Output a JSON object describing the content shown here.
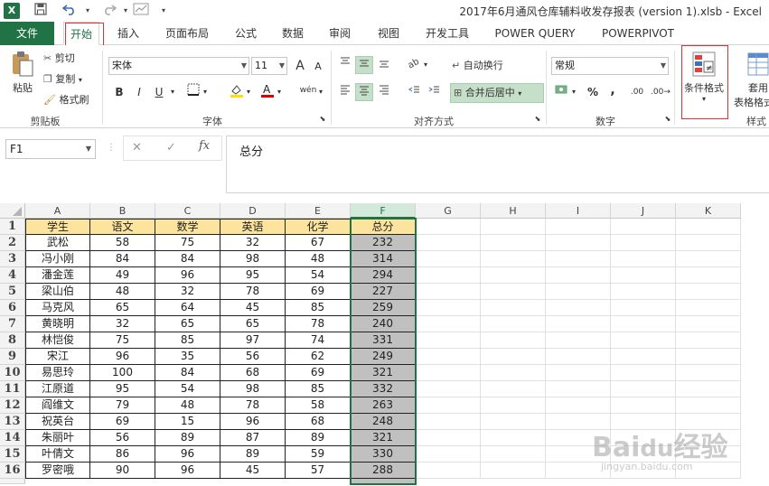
{
  "window": {
    "title": "2017年6月通风仓库辅料收发存报表 (version 1).xlsb - Excel"
  },
  "quick_access": {
    "logo": "X",
    "save_icon": "save-icon",
    "undo_icon": "undo-icon",
    "redo_icon": "redo-icon"
  },
  "tabs": [
    {
      "label": "文件"
    },
    {
      "label": "开始"
    },
    {
      "label": "插入"
    },
    {
      "label": "页面布局"
    },
    {
      "label": "公式"
    },
    {
      "label": "数据"
    },
    {
      "label": "审阅"
    },
    {
      "label": "视图"
    },
    {
      "label": "开发工具"
    },
    {
      "label": "POWER QUERY"
    },
    {
      "label": "POWERPIVOT"
    }
  ],
  "ribbon": {
    "clipboard": {
      "paste": "粘贴",
      "cut": "剪切",
      "copy": "复制",
      "format_painter": "格式刷",
      "label": "剪贴板"
    },
    "font": {
      "name": "宋体",
      "size": "11",
      "bold": "B",
      "italic": "I",
      "underline": "U",
      "wen": "wén",
      "a_big": "A",
      "a_small": "A",
      "label": "字体"
    },
    "alignment": {
      "wrap": "自动换行",
      "merge": "合并后居中",
      "label": "对齐方式"
    },
    "number": {
      "format": "常规",
      "percent": "%",
      "comma": ",",
      "inc": ".00",
      "label": "数字"
    },
    "styles": {
      "conditional": "条件格式",
      "table_format_1": "套用",
      "table_format_2": "表格格式",
      "label": "样式"
    }
  },
  "formula_bar": {
    "name_box": "F1",
    "content": "总分",
    "cancel": "✕",
    "confirm": "✓",
    "fx": "fx"
  },
  "sheet": {
    "columns": [
      "A",
      "B",
      "C",
      "D",
      "E",
      "F",
      "G",
      "H",
      "I",
      "J",
      "K"
    ],
    "rows": [
      "1",
      "2",
      "3",
      "4",
      "5",
      "6",
      "7",
      "8",
      "9",
      "10",
      "11",
      "12",
      "13",
      "14",
      "15",
      "16"
    ],
    "header": [
      "学生",
      "语文",
      "数学",
      "英语",
      "化学",
      "总分"
    ],
    "data": [
      [
        "武松",
        "58",
        "75",
        "32",
        "67",
        "232"
      ],
      [
        "冯小刚",
        "84",
        "84",
        "98",
        "48",
        "314"
      ],
      [
        "潘金莲",
        "49",
        "96",
        "95",
        "54",
        "294"
      ],
      [
        "梁山伯",
        "48",
        "32",
        "78",
        "69",
        "227"
      ],
      [
        "马克风",
        "65",
        "64",
        "45",
        "85",
        "259"
      ],
      [
        "黄晓明",
        "32",
        "65",
        "65",
        "78",
        "240"
      ],
      [
        "林恺俊",
        "75",
        "85",
        "97",
        "74",
        "331"
      ],
      [
        "宋江",
        "96",
        "35",
        "56",
        "62",
        "249"
      ],
      [
        "易思玲",
        "100",
        "84",
        "68",
        "69",
        "321"
      ],
      [
        "江原道",
        "95",
        "54",
        "98",
        "85",
        "332"
      ],
      [
        "阎维文",
        "79",
        "48",
        "78",
        "58",
        "263"
      ],
      [
        "祝英台",
        "69",
        "15",
        "96",
        "68",
        "248"
      ],
      [
        "朱丽叶",
        "56",
        "89",
        "87",
        "89",
        "321"
      ],
      [
        "叶倩文",
        "86",
        "96",
        "89",
        "59",
        "330"
      ],
      [
        "罗密哦",
        "90",
        "96",
        "45",
        "57",
        "288"
      ]
    ]
  },
  "colors": {
    "excel_green": "#217346",
    "header_fill": "#fde49c",
    "total_fill": "#c0c0c0"
  }
}
